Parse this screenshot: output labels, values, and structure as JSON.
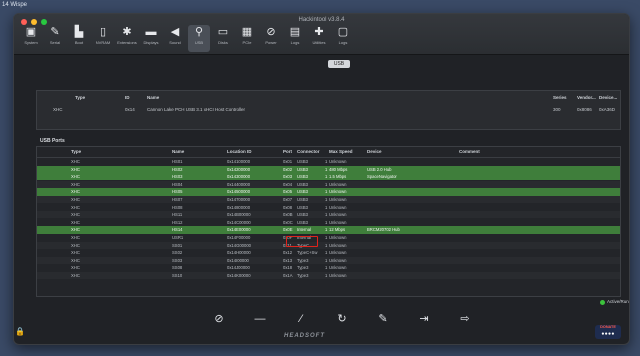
{
  "desktop_tag": "14 Wispe",
  "window": {
    "title": "Hackintool v3.8.4"
  },
  "toolbar": [
    {
      "label": "System",
      "icon": "monitor-icon",
      "glyph": "▣"
    },
    {
      "label": "Serial",
      "icon": "pencil-icon",
      "glyph": "✎"
    },
    {
      "label": "Boot",
      "icon": "boot-icon",
      "glyph": "▙"
    },
    {
      "label": "NVRAM",
      "icon": "memory-icon",
      "glyph": "▯"
    },
    {
      "label": "Extensions",
      "icon": "puzzle-icon",
      "glyph": "✱"
    },
    {
      "label": "Displays",
      "icon": "display-icon",
      "glyph": "▬"
    },
    {
      "label": "Sound",
      "icon": "speaker-icon",
      "glyph": "◀"
    },
    {
      "label": "USB",
      "icon": "usb-icon",
      "glyph": "⚲",
      "active": true
    },
    {
      "label": "Disks",
      "icon": "disk-icon",
      "glyph": "▭"
    },
    {
      "label": "PCIe",
      "icon": "card-icon",
      "glyph": "▦"
    },
    {
      "label": "Power",
      "icon": "power-icon",
      "glyph": "⊘"
    },
    {
      "label": "Logs",
      "icon": "log-icon",
      "glyph": "▤"
    },
    {
      "label": "Utilities",
      "icon": "wrench-icon",
      "glyph": "✚"
    },
    {
      "label": "Logs",
      "icon": "document-icon",
      "glyph": "▢"
    }
  ],
  "segment": {
    "label": "USB"
  },
  "controller": {
    "headers": {
      "type": "Type",
      "id": "ID",
      "name": "Name",
      "series": "Series",
      "vendor": "Vendor...",
      "device": "Device..."
    },
    "row": {
      "type": "XHC",
      "id": "0x14",
      "name": "Cannon Lake PCH USB 3.1 xHCI Host Controller",
      "series": "300",
      "vendor": "0x8086",
      "device": "0xA36D"
    }
  },
  "ports": {
    "label": "USB Ports",
    "headers": {
      "type": "Type",
      "name": "Name",
      "location": "Location ID",
      "port": "Port",
      "connector": "Connector",
      "speed": "Max Speed",
      "device": "Device",
      "comment": "Comment"
    },
    "rows": [
      {
        "type": "XHC",
        "name": "HS01",
        "location": "0x14100000",
        "port": "0x01",
        "connector": "USB3",
        "num": "1",
        "speed": "Unknown",
        "device": "",
        "hl": false
      },
      {
        "type": "XHC",
        "name": "HS02",
        "location": "0x14200000",
        "port": "0x02",
        "connector": "USB3",
        "num": "1",
        "speed": "480 Mbps",
        "device": "USB 2.0 Hub",
        "hl": true
      },
      {
        "type": "XHC",
        "name": "HS03",
        "location": "0x14300000",
        "port": "0x03",
        "connector": "USB3",
        "num": "1",
        "speed": "1.5 Mbps",
        "device": "SpaceNavigator",
        "hl": true
      },
      {
        "type": "XHC",
        "name": "HS04",
        "location": "0x14400000",
        "port": "0x04",
        "connector": "USB3",
        "num": "1",
        "speed": "Unknown",
        "device": "",
        "hl": false
      },
      {
        "type": "XHC",
        "name": "HS05",
        "location": "0x14500000",
        "port": "0x05",
        "connector": "USB3",
        "num": "1",
        "speed": "Unknown",
        "device": "",
        "hl": true
      },
      {
        "type": "XHC",
        "name": "HS07",
        "location": "0x14700000",
        "port": "0x07",
        "connector": "USB3",
        "num": "1",
        "speed": "Unknown",
        "device": "",
        "hl": false
      },
      {
        "type": "XHC",
        "name": "HS08",
        "location": "0x14800000",
        "port": "0x08",
        "connector": "USB3",
        "num": "1",
        "speed": "Unknown",
        "device": "",
        "hl": false
      },
      {
        "type": "XHC",
        "name": "HS11",
        "location": "0x14B00000",
        "port": "0x0B",
        "connector": "USB3",
        "num": "1",
        "speed": "Unknown",
        "device": "",
        "hl": false
      },
      {
        "type": "XHC",
        "name": "HS12",
        "location": "0x14C00000",
        "port": "0x0C",
        "connector": "USB3",
        "num": "1",
        "speed": "Unknown",
        "device": "",
        "hl": false
      },
      {
        "type": "XHC",
        "name": "HS14",
        "location": "0x14E00000",
        "port": "0x0E",
        "connector": "Internal",
        "num": "1",
        "speed": "12 Mbps",
        "device": "BRCM20702 Hub",
        "hl": true
      },
      {
        "type": "XHC",
        "name": "USR1",
        "location": "0x14F00000",
        "port": "0x0F",
        "connector": "Internal",
        "num": "1",
        "speed": "Unknown",
        "device": "",
        "hl": false
      },
      {
        "type": "XHC",
        "name": "SS01",
        "location": "0x14G00000",
        "port": "0x11",
        "connector": "TypeC",
        "num": "1",
        "speed": "Unknown",
        "device": "",
        "hl": false
      },
      {
        "type": "XHC",
        "name": "SS02",
        "location": "0x14H00000",
        "port": "0x12",
        "connector": "TypeC+Sw",
        "num": "1",
        "speed": "Unknown",
        "device": "",
        "hl": false
      },
      {
        "type": "XHC",
        "name": "SS03",
        "location": "0x14I00000",
        "port": "0x13",
        "connector": "Type3",
        "num": "1",
        "speed": "Unknown",
        "device": "",
        "hl": false
      },
      {
        "type": "XHC",
        "name": "SS08",
        "location": "0x14J00000",
        "port": "0x18",
        "connector": "Type3",
        "num": "1",
        "speed": "Unknown",
        "device": "",
        "hl": false
      },
      {
        "type": "XHC",
        "name": "SS10",
        "location": "0x14K00000",
        "port": "0x1A",
        "connector": "Type3",
        "num": "1",
        "speed": "Unknown",
        "device": "",
        "hl": false
      }
    ]
  },
  "actions": [
    {
      "name": "clear-button",
      "icon": "clear-icon",
      "glyph": "⊘"
    },
    {
      "name": "remove-button",
      "icon": "minus-icon",
      "glyph": "—"
    },
    {
      "name": "clean-button",
      "icon": "broom-icon",
      "glyph": "⁄"
    },
    {
      "name": "refresh-button",
      "icon": "refresh-icon",
      "glyph": "↻"
    },
    {
      "name": "edit-button",
      "icon": "pencil-icon",
      "glyph": "✎"
    },
    {
      "name": "import-button",
      "icon": "import-icon",
      "glyph": "⇥"
    },
    {
      "name": "export-button",
      "icon": "export-icon",
      "glyph": "⇨"
    }
  ],
  "status": {
    "text": "Active/Run",
    "color": "#3cc23c"
  },
  "brand": "HEADSOFT",
  "donate": {
    "label": "DONATE",
    "icons": "●●●●"
  },
  "colors": {
    "highlight": "#3f7e3b",
    "redbox": "#e0231b"
  }
}
